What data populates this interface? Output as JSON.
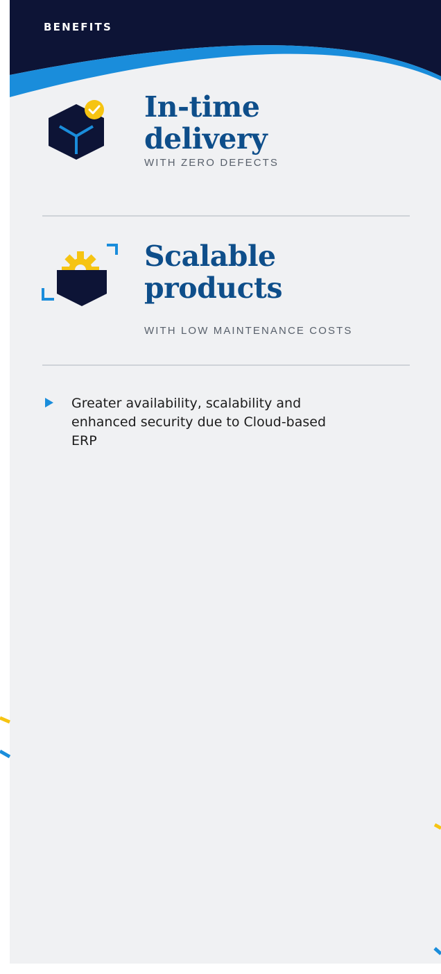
{
  "header": {
    "label": "BENEFITS"
  },
  "benefits": [
    {
      "title_line1": "In-time",
      "title_line2": "delivery",
      "subtitle": "WITH ZERO DEFECTS",
      "icon": "box-check-icon"
    },
    {
      "title_line1": "Scalable",
      "title_line2": "products",
      "subtitle": "WITH LOW MAINTENANCE COSTS",
      "icon": "gear-box-icon"
    }
  ],
  "bullets": [
    "Greater availability, scalability and enhanced security due to Cloud-based ERP"
  ],
  "colors": {
    "navy": "#0d1436",
    "brand_blue": "#0e4e8a",
    "accent_blue": "#1a8ddb",
    "accent_yellow": "#f6c412",
    "panel_bg": "#f0f1f3"
  }
}
